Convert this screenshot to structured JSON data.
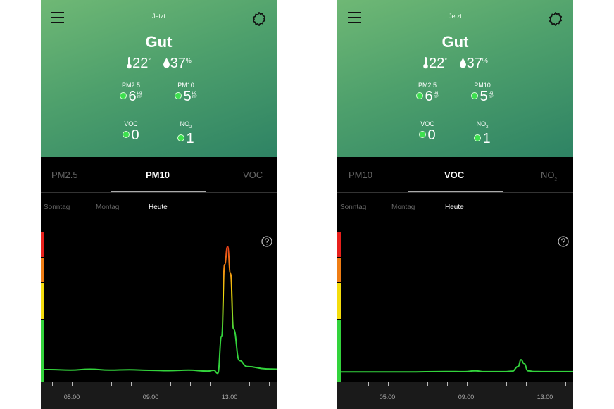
{
  "screens": [
    {
      "time_label": "Jetzt",
      "status": "Gut",
      "temperature": {
        "value": "22",
        "unit": "°"
      },
      "humidity": {
        "value": "37",
        "unit": "%"
      },
      "metrics": [
        {
          "name": "PM2.5",
          "value": "6",
          "unit_top": "µg",
          "unit_bottom": "m³"
        },
        {
          "name": "PM10",
          "value": "5",
          "unit_top": "µg",
          "unit_bottom": "m³"
        },
        {
          "name": "VOC",
          "value": "0"
        },
        {
          "name": "NO",
          "name_sub": "2",
          "value": "1"
        }
      ],
      "tabs": [
        {
          "label": "PM2.5",
          "state": "inactive"
        },
        {
          "label": "PM10",
          "state": "active"
        },
        {
          "label": "VOC",
          "state": "inactive"
        }
      ],
      "days": [
        {
          "label": "Sonntag",
          "state": "inactive"
        },
        {
          "label": "Montag",
          "state": "inactive"
        },
        {
          "label": "Heute",
          "state": "active"
        }
      ],
      "scale_colors": [
        "#e8201c",
        "#ef7d14",
        "#f4dd0d",
        "#33d33c"
      ],
      "time_labels": [
        "05:00",
        "09:00",
        "13:00"
      ],
      "chart_data": {
        "type": "line",
        "x_labels": [
          "05:00",
          "09:00",
          "13:00"
        ],
        "series": [
          {
            "x": [
              3.5,
              4.0,
              5.0,
              6.0,
              7.0,
              8.0,
              9.0,
              10.0,
              11.0,
              12.0,
              12.3,
              12.5,
              12.7,
              12.85,
              13.0,
              13.15,
              13.3,
              13.6,
              14.0,
              15.0,
              15.5
            ],
            "y": [
              8,
              8,
              7.6,
              8.2,
              7.6,
              7.9,
              7.5,
              7.3,
              7.6,
              7.0,
              7.5,
              5.5,
              30,
              78,
              90,
              72,
              35,
              14,
              10,
              8.4,
              8.2
            ]
          }
        ],
        "ylim": [
          0,
          100
        ],
        "xlim": [
          3.5,
          15.5
        ]
      }
    },
    {
      "time_label": "Jetzt",
      "status": "Gut",
      "temperature": {
        "value": "22",
        "unit": "°"
      },
      "humidity": {
        "value": "37",
        "unit": "%"
      },
      "metrics": [
        {
          "name": "PM2.5",
          "value": "6",
          "unit_top": "µg",
          "unit_bottom": "m³"
        },
        {
          "name": "PM10",
          "value": "5",
          "unit_top": "µg",
          "unit_bottom": "m³"
        },
        {
          "name": "VOC",
          "value": "0"
        },
        {
          "name": "NO",
          "name_sub": "2",
          "value": "1"
        }
      ],
      "tabs": [
        {
          "label": "PM10",
          "state": "inactive"
        },
        {
          "label": "VOC",
          "state": "active"
        },
        {
          "label": "NO",
          "label_sub": "2",
          "state": "inactive"
        }
      ],
      "days": [
        {
          "label": "Sonntag",
          "state": "inactive"
        },
        {
          "label": "Montag",
          "state": "inactive"
        },
        {
          "label": "Heute",
          "state": "active"
        }
      ],
      "scale_colors": [
        "#e8201c",
        "#ef7d14",
        "#f4dd0d",
        "#33d33c"
      ],
      "time_labels": [
        "05:00",
        "09:00",
        "13:00"
      ],
      "chart_data": {
        "type": "line",
        "x_labels": [
          "05:00",
          "09:00",
          "13:00"
        ],
        "series": [
          {
            "x": [
              3.5,
              5.0,
              7.0,
              9.0,
              10.0,
              10.5,
              11.0,
              12.0,
              12.4,
              12.7,
              12.85,
              13.0,
              13.2,
              13.5,
              14.0,
              15.5
            ],
            "y": [
              6.5,
              6.5,
              6.5,
              6.7,
              6.6,
              7.2,
              6.6,
              6.6,
              6.9,
              10,
              14.5,
              12,
              7.2,
              6.7,
              6.6,
              6.6
            ]
          }
        ],
        "ylim": [
          0,
          100
        ],
        "xlim": [
          3.5,
          15.5
        ]
      }
    }
  ]
}
